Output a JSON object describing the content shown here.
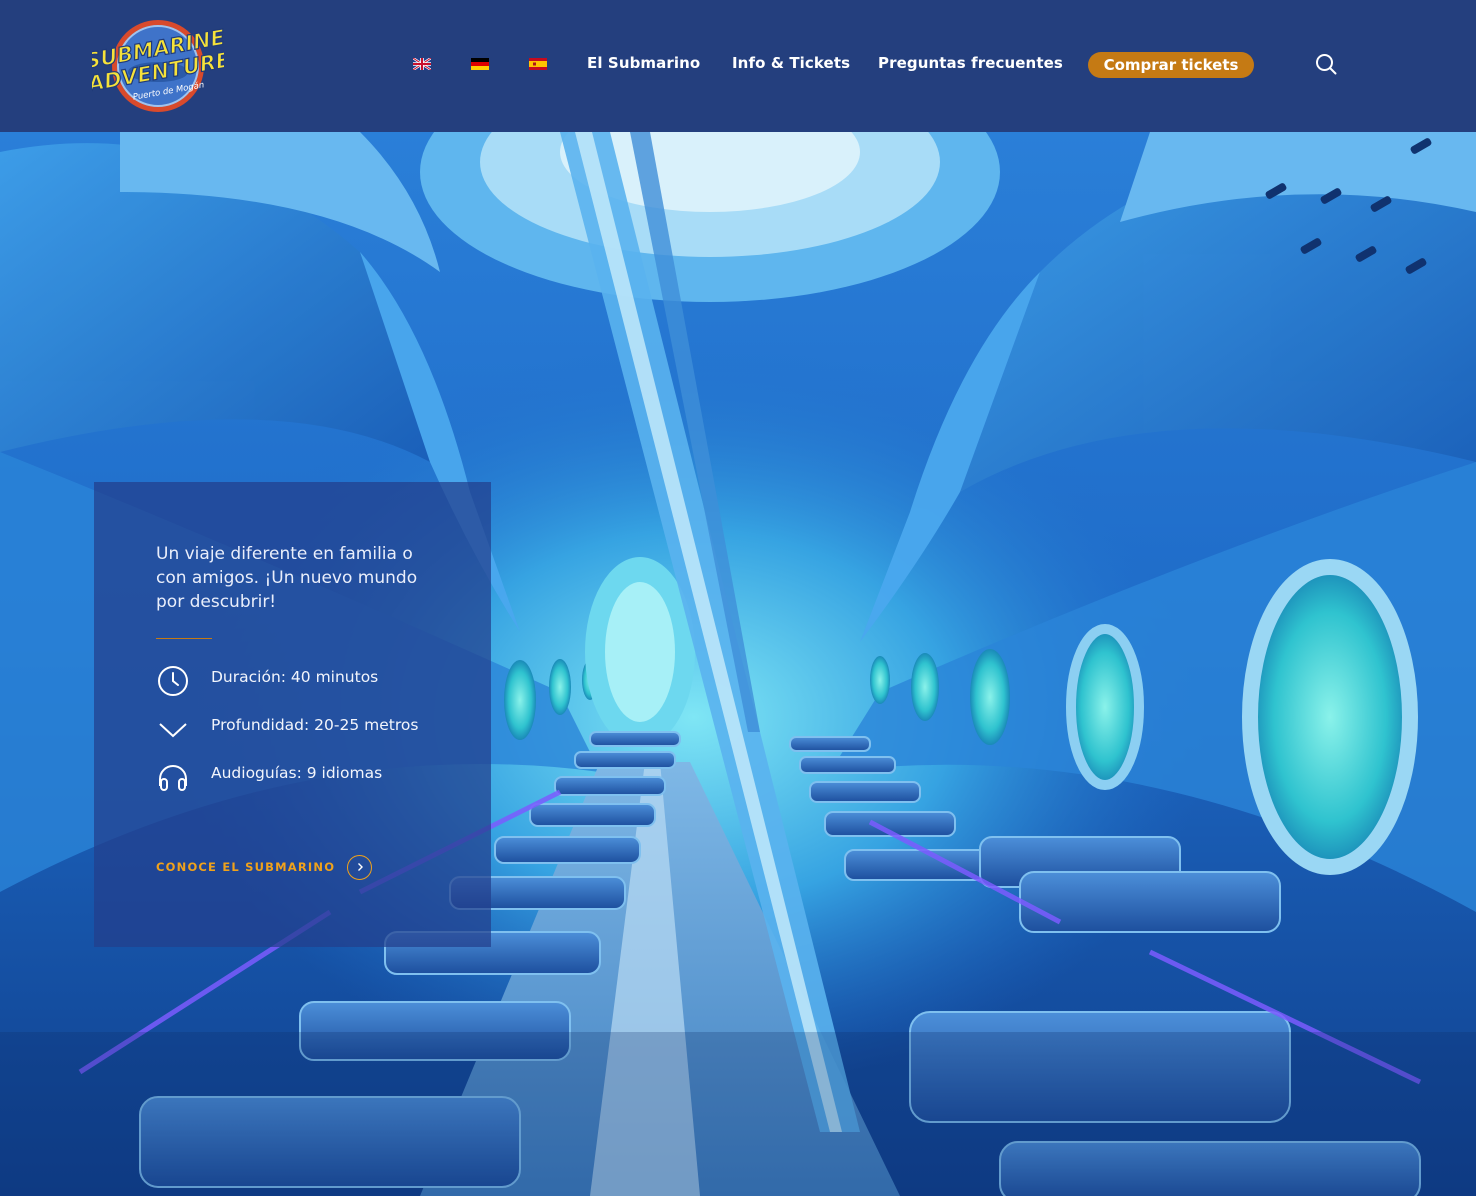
{
  "logo": {
    "line1": "SUBMARINE",
    "line2": "ADVENTURE",
    "line3": "Puerto de Mogán"
  },
  "nav": {
    "languages": [
      {
        "code": "en",
        "icon": "flag-uk-icon"
      },
      {
        "code": "de",
        "icon": "flag-de-icon"
      },
      {
        "code": "es",
        "icon": "flag-es-icon"
      }
    ],
    "links": [
      "El Submarino",
      "Info & Tickets",
      "Preguntas frecuentes"
    ],
    "buy_label": "Comprar tickets",
    "search_icon": "search-icon"
  },
  "hero": {
    "tagline": "Un viaje diferente en familia o con amigos. ¡Un nuevo mundo por descubrir!",
    "features": [
      {
        "icon": "clock-icon",
        "text": "Duración: 40 minutos"
      },
      {
        "icon": "chevron-down-icon",
        "text": "Profundidad: 20-25 metros"
      },
      {
        "icon": "headphones-icon",
        "text": "Audioguías: 9 idiomas"
      }
    ],
    "cta_label": "CONOCE EL SUBMARINO",
    "cta_icon": "chevron-right-icon"
  },
  "colors": {
    "header_bg": "#243f7e",
    "accent": "#c57a14",
    "cta_text": "#f0a21b",
    "card_bg": "rgba(34,62,140,0.72)"
  }
}
